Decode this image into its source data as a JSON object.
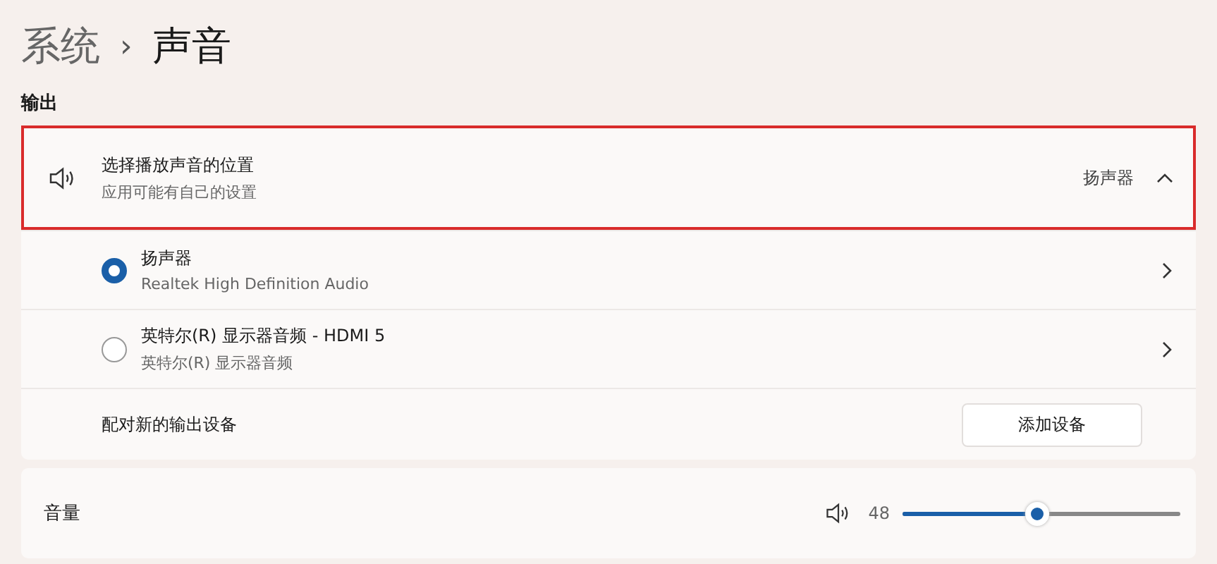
{
  "breadcrumb": {
    "parent": "系统",
    "separator": "›",
    "current": "声音"
  },
  "section": "输出",
  "output": {
    "title": "选择播放声音的位置",
    "subtitle": "应用可能有自己的设置",
    "value": "扬声器",
    "expanded": true,
    "highlighted": true,
    "devices": [
      {
        "name": "扬声器",
        "detail": "Realtek High Definition Audio",
        "selected": true
      },
      {
        "name": "英特尔(R) 显示器音频 - HDMI 5",
        "detail": "英特尔(R) 显示器音频",
        "selected": false
      }
    ],
    "pair": {
      "label": "配对新的输出设备",
      "button": "添加设备"
    }
  },
  "volume": {
    "label": "音量",
    "reading": "48",
    "level": 0.48
  }
}
